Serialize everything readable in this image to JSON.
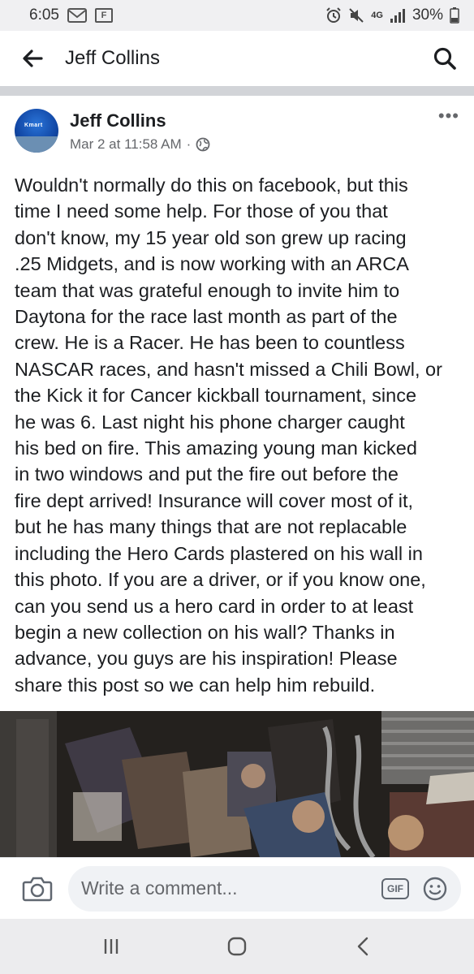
{
  "status_bar": {
    "time": "6:05",
    "network": "4G",
    "battery": "30%",
    "icons": [
      "gmail-icon",
      "flipboard-icon",
      "alarm-icon",
      "mute-icon",
      "signal-icon",
      "battery-icon"
    ],
    "flipboard_letter": "F"
  },
  "header": {
    "title": "Jeff Collins",
    "back_icon": "arrow-left-icon",
    "search_icon": "search-icon"
  },
  "post": {
    "author": "Jeff Collins",
    "avatar_brand": "Kmart",
    "timestamp": "Mar 2 at 11:58 AM",
    "separator": "·",
    "privacy_icon": "globe-icon",
    "more_label": "•••",
    "body_lines": [
      "Wouldn't normally do this on facebook, but this",
      "time I need some help.  For those of you that",
      "don't know, my 15 year old son grew up racing",
      ".25 Midgets,  and is now working with an ARCA",
      "team that was grateful enough to invite him to",
      "Daytona for the race last month as part of the",
      "crew.  He is a Racer.  He has been to countless",
      "NASCAR races, and hasn't missed a Chili Bowl, or",
      "the Kick it for Cancer kickball tournament, since",
      "he was 6.  Last night his phone charger caught",
      "his bed on fire.  This amazing young man kicked",
      "in two windows and put the fire out before the",
      "fire dept arrived! Insurance will cover most of it,",
      "but he has many things that are not replacable",
      "including the Hero Cards plastered on his wall in",
      "this photo.  If you are a driver, or if you know one,",
      "can you send us a hero card in order to at least",
      "begin a new collection on his wall?  Thanks in",
      "advance, you guys are his inspiration!  Please",
      "share this post so we can help him rebuild."
    ]
  },
  "comment_bar": {
    "camera_icon": "camera-icon",
    "placeholder": "Write a comment...",
    "gif_label": "GIF",
    "emoji_icon": "smiley-icon"
  },
  "nav_bar": {
    "icons": [
      "recent-apps-icon",
      "home-icon",
      "back-icon"
    ]
  },
  "colors": {
    "status_bg": "#f0f0f2",
    "divider": "#d2d4d8",
    "text_primary": "#1c1e21",
    "text_secondary": "#65676b",
    "input_bg": "#f0f2f5",
    "nav_bg": "#ececee"
  }
}
